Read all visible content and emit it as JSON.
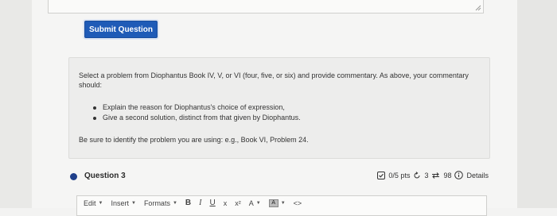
{
  "submit": {
    "label": "Submit Question"
  },
  "question": {
    "text": "Select a problem from Diophantus Book IV, V, or VI (four, five, or six) and provide commentary.  As above, your commentary should:",
    "bullets": [
      "Explain the reason for Diophantus's choice of expression,",
      "Give a second solution, distinct from that given by Diophantus."
    ],
    "footer": "Be sure to identify the problem you are using:  e.g., Book VI, Problem 24."
  },
  "question3": {
    "title": "Question 3",
    "points": "0/5 pts",
    "retries": "3",
    "attempts": "98",
    "details": "Details"
  },
  "toolbar": {
    "edit": "Edit",
    "insert": "Insert",
    "formats": "Formats",
    "bold": "B",
    "italic": "I",
    "underline": "U",
    "clear": "x",
    "superscript": "x²",
    "font_color": "A",
    "highlight": "A",
    "code": "<>"
  },
  "colors": {
    "submit_bg": "#1f5bb7",
    "status_dot": "#1f3f8a"
  }
}
